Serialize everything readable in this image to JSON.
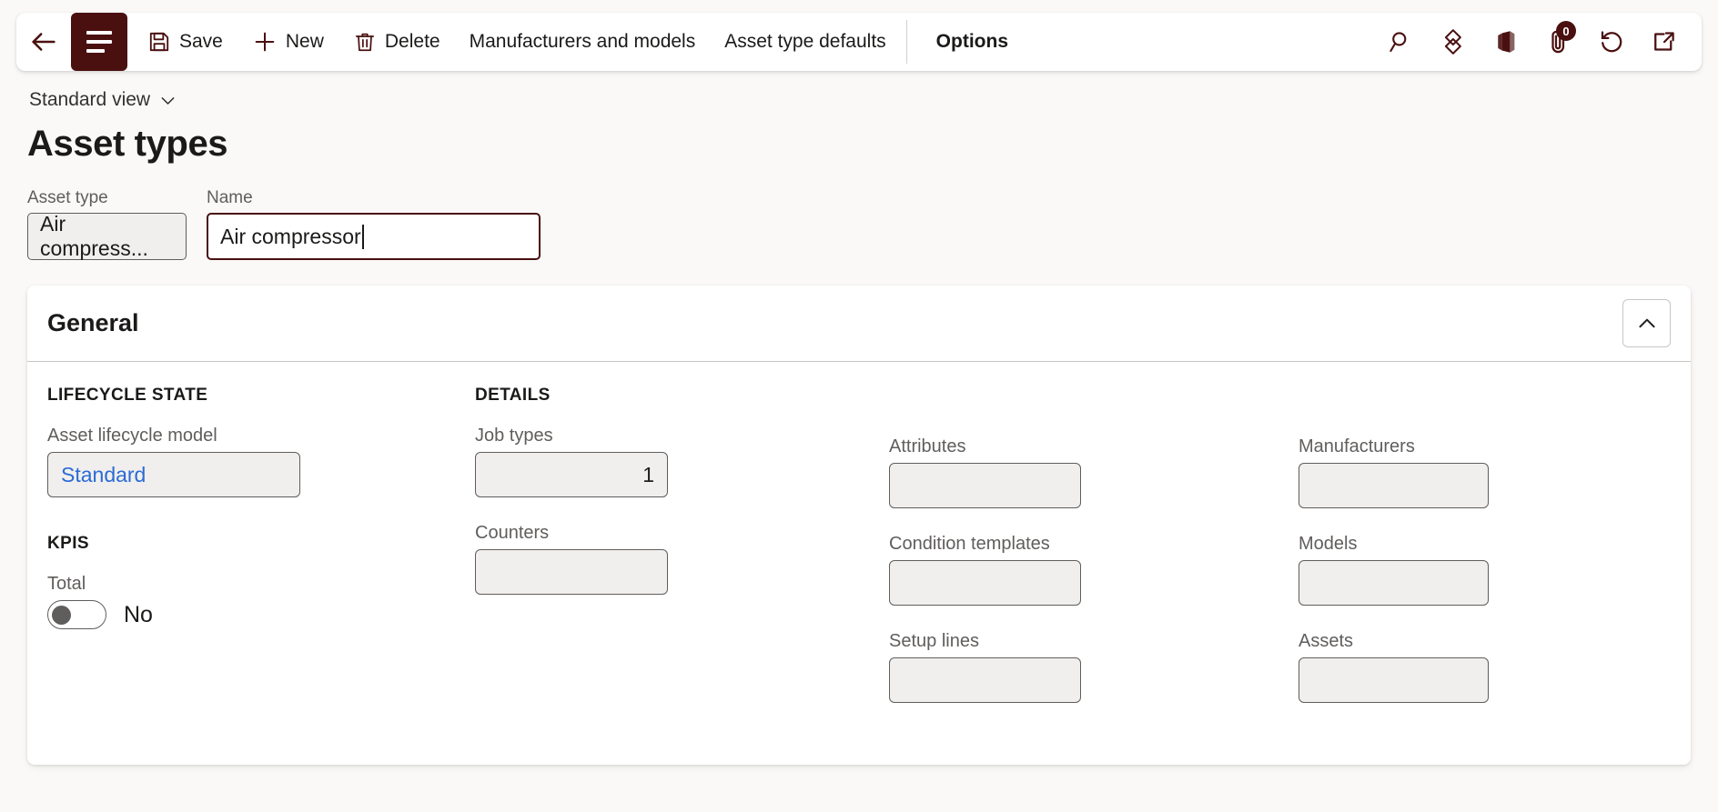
{
  "theme": {
    "accent": "#4a1010",
    "page_bg": "#faf9f8",
    "panel_bg": "#ffffff",
    "field_bg": "#f0efee",
    "link_blue": "#2b6bd4",
    "border": "#605e5c"
  },
  "commandbar": {
    "back_icon": "back-arrow-icon",
    "nav_icon": "hamburger-menu-icon",
    "items": [
      {
        "id": "save",
        "label": "Save",
        "icon": "floppy-disk-icon"
      },
      {
        "id": "new",
        "label": "New",
        "icon": "plus-icon"
      },
      {
        "id": "delete",
        "label": "Delete",
        "icon": "trash-icon"
      },
      {
        "id": "manufacturers-and-models",
        "label": "Manufacturers and models",
        "icon": ""
      },
      {
        "id": "asset-type-defaults",
        "label": "Asset type defaults",
        "icon": ""
      },
      {
        "id": "options",
        "label": "Options",
        "icon": ""
      }
    ],
    "icons": [
      {
        "id": "search",
        "name": "search-icon"
      },
      {
        "id": "copilot",
        "name": "copilot-diamond-icon"
      },
      {
        "id": "office-panel",
        "name": "office-panel-icon"
      },
      {
        "id": "attachments",
        "name": "paperclip-icon",
        "badge": "0"
      },
      {
        "id": "refresh",
        "name": "refresh-icon"
      },
      {
        "id": "popout",
        "name": "open-in-new-window-icon"
      }
    ]
  },
  "page": {
    "view_selector": "Standard view",
    "title": "Asset types"
  },
  "header_fields": [
    {
      "id": "asset-type",
      "label": "Asset type",
      "value": "Air compress...",
      "readonly": true
    },
    {
      "id": "name",
      "label": "Name",
      "value": "Air compressor",
      "focused": true
    }
  ],
  "general_panel": {
    "title": "General",
    "collapse_icon": "chevron-up-icon",
    "columns": [
      {
        "id": "lifecycle",
        "sections": [
          {
            "heading": "LIFECYCLE STATE",
            "fields": [
              {
                "id": "asset-lifecycle-model",
                "label": "Asset lifecycle model",
                "value": "Standard",
                "type": "link"
              }
            ]
          },
          {
            "heading": "KPIS",
            "fields": [
              {
                "id": "total",
                "label": "Total",
                "value": "No",
                "type": "toggle",
                "checked": false
              }
            ]
          }
        ]
      },
      {
        "id": "details",
        "sections": [
          {
            "heading": "DETAILS",
            "fields": [
              {
                "id": "job-types",
                "label": "Job types",
                "value": "1",
                "type": "number"
              },
              {
                "id": "counters",
                "label": "Counters",
                "value": "",
                "type": "number"
              }
            ]
          }
        ]
      },
      {
        "id": "attributes-col",
        "sections": [
          {
            "heading": "",
            "fields": [
              {
                "id": "attributes",
                "label": "Attributes",
                "value": "",
                "type": "text"
              },
              {
                "id": "condition-templates",
                "label": "Condition templates",
                "value": "",
                "type": "text"
              },
              {
                "id": "setup-lines",
                "label": "Setup lines",
                "value": "",
                "type": "text"
              }
            ]
          }
        ]
      },
      {
        "id": "manufacturers-col",
        "sections": [
          {
            "heading": "",
            "fields": [
              {
                "id": "manufacturers",
                "label": "Manufacturers",
                "value": "",
                "type": "text"
              },
              {
                "id": "models",
                "label": "Models",
                "value": "",
                "type": "text"
              },
              {
                "id": "assets",
                "label": "Assets",
                "value": "",
                "type": "text"
              }
            ]
          }
        ]
      }
    ]
  }
}
